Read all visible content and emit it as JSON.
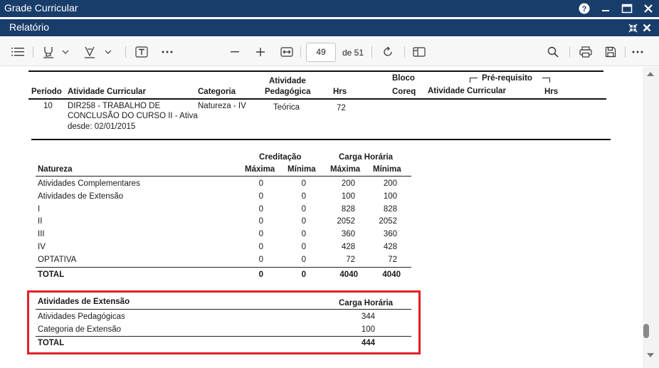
{
  "window": {
    "title": "Grade Curricular"
  },
  "panel": {
    "title": "Relatório"
  },
  "toolbar": {
    "page_current": "49",
    "page_of": "de 51"
  },
  "course_table": {
    "headers": {
      "periodo": "Período",
      "atividade": "Atividade Curricular",
      "categoria": "Categoria",
      "atividade_ped_1": "Atividade",
      "atividade_ped_2": "Pedagógica",
      "hrs": "Hrs",
      "bloco": "Bloco",
      "coreq": "Coreq",
      "prereq": "Pré-requisito",
      "prereq_atividade": "Atividade Curricular",
      "prereq_hrs": "Hrs"
    },
    "row": {
      "periodo": "10",
      "atividade_1": "DIR258 - TRABALHO DE",
      "atividade_2": "CONCLUSÃO DO CURSO II - Ativa",
      "atividade_3": "desde: 02/01/2015",
      "categoria": "Natureza - IV",
      "atividade_ped": "Teórica",
      "hrs": "72"
    }
  },
  "natureza_table": {
    "group_creditacao": "Creditação",
    "group_carga": "Carga Horária",
    "col_natureza": "Natureza",
    "col_maxima": "Máxima",
    "col_minima": "Mínima",
    "col_maxima2": "Máxima",
    "col_minima2": "Mínima",
    "rows": [
      {
        "natureza": "Atividades Complementares",
        "cmax": "0",
        "cmin": "0",
        "hmax": "200",
        "hmin": "200"
      },
      {
        "natureza": "Atividades de Extensão",
        "cmax": "0",
        "cmin": "0",
        "hmax": "100",
        "hmin": "100"
      },
      {
        "natureza": "I",
        "cmax": "0",
        "cmin": "0",
        "hmax": "828",
        "hmin": "828"
      },
      {
        "natureza": "II",
        "cmax": "0",
        "cmin": "0",
        "hmax": "2052",
        "hmin": "2052"
      },
      {
        "natureza": "III",
        "cmax": "0",
        "cmin": "0",
        "hmax": "360",
        "hmin": "360"
      },
      {
        "natureza": "IV",
        "cmax": "0",
        "cmin": "0",
        "hmax": "428",
        "hmin": "428"
      },
      {
        "natureza": "OPTATIVA",
        "cmax": "0",
        "cmin": "0",
        "hmax": "72",
        "hmin": "72"
      }
    ],
    "total": {
      "label": "TOTAL",
      "cmax": "0",
      "cmin": "0",
      "hmax": "4040",
      "hmin": "4040"
    }
  },
  "extensao_table": {
    "col_atividades": "Atividades de Extensão",
    "col_carga": "Carga Horária",
    "rows": [
      {
        "label": "Atividades Pedagógicas",
        "value": "344"
      },
      {
        "label": "Categoria de Extensão",
        "value": "100"
      }
    ],
    "total": {
      "label": "TOTAL",
      "value": "444"
    }
  },
  "colors": {
    "titlebar": "#193d6b",
    "highlight": "#e0202a"
  }
}
